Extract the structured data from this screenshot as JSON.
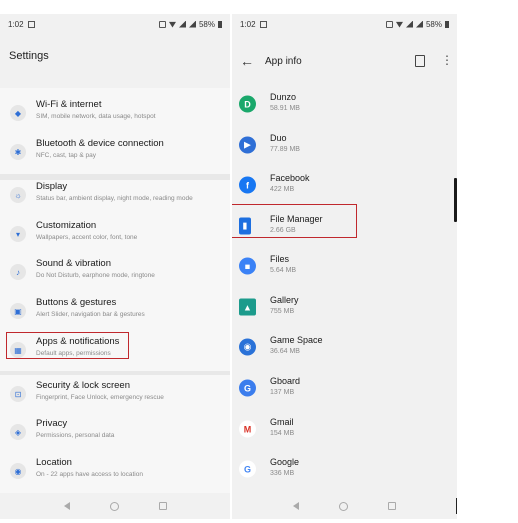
{
  "left": {
    "status": {
      "time": "1:02",
      "battery": "58%"
    },
    "title": "Settings",
    "items": [
      {
        "label": "Wi-Fi & internet",
        "sub": "SIM, mobile network, data usage, hotspot",
        "icon": "wifi-icon"
      },
      {
        "label": "Bluetooth & device connection",
        "sub": "NFC, cast, tap & pay",
        "icon": "bluetooth-icon"
      },
      {
        "label": "Display",
        "sub": "Status bar, ambient display, night mode, reading mode",
        "icon": "display-icon"
      },
      {
        "label": "Customization",
        "sub": "Wallpapers, accent color, font, tone",
        "icon": "customization-icon"
      },
      {
        "label": "Sound & vibration",
        "sub": "Do Not Disturb, earphone mode, ringtone",
        "icon": "sound-icon"
      },
      {
        "label": "Buttons & gestures",
        "sub": "Alert Slider, navigation bar & gestures",
        "icon": "buttons-icon"
      },
      {
        "label": "Apps & notifications",
        "sub": "Default apps, permissions",
        "icon": "apps-icon"
      },
      {
        "label": "Security & lock screen",
        "sub": "Fingerprint, Face Unlock, emergency rescue",
        "icon": "lock-icon"
      },
      {
        "label": "Privacy",
        "sub": "Permissions, personal data",
        "icon": "privacy-icon"
      },
      {
        "label": "Location",
        "sub": "On - 22 apps have access to location",
        "icon": "location-icon"
      }
    ]
  },
  "right": {
    "status": {
      "time": "1:02",
      "battery": "58%"
    },
    "title": "App info",
    "apps": [
      {
        "name": "Dunzo",
        "size": "58.91 MB",
        "color": "#1aa86b",
        "glyph": "D"
      },
      {
        "name": "Duo",
        "size": "77.89 MB",
        "color": "#2f6fd6",
        "glyph": "▶"
      },
      {
        "name": "Facebook",
        "size": "422 MB",
        "color": "#1877f2",
        "glyph": "f"
      },
      {
        "name": "File Manager",
        "size": "2.66 GB",
        "color": "#1d6fe0",
        "glyph": "▮"
      },
      {
        "name": "Files",
        "size": "5.64 MB",
        "color": "#3b82f6",
        "glyph": "■"
      },
      {
        "name": "Gallery",
        "size": "755 MB",
        "color": "#1c9b8c",
        "glyph": "▲"
      },
      {
        "name": "Game Space",
        "size": "36.64 MB",
        "color": "#2a72d8",
        "glyph": "◉"
      },
      {
        "name": "Gboard",
        "size": "137 MB",
        "color": "#3b7ded",
        "glyph": "G"
      },
      {
        "name": "Gmail",
        "size": "154 MB",
        "color": "#ffffff",
        "glyph": "M"
      },
      {
        "name": "Google",
        "size": "336 MB",
        "color": "#ffffff",
        "glyph": "G"
      }
    ]
  },
  "colors": {
    "highlight": "#c0282d",
    "accent": "#2f6fd6"
  }
}
